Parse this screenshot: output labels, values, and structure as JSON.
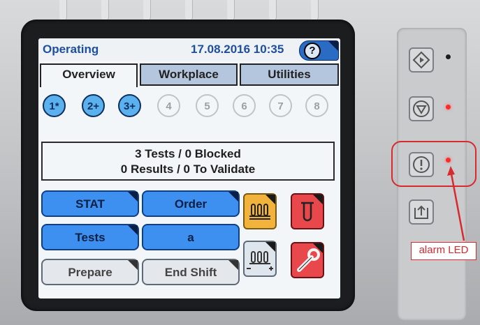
{
  "status": {
    "mode": "Operating",
    "datetime": "17.08.2016 10:35",
    "help_label": "?"
  },
  "tabs": [
    {
      "label": "Overview",
      "active": true
    },
    {
      "label": "Workplace",
      "active": false
    },
    {
      "label": "Utilities",
      "active": false
    }
  ],
  "racks": [
    {
      "label": "1*",
      "active": true
    },
    {
      "label": "2+",
      "active": true
    },
    {
      "label": "3+",
      "active": true
    },
    {
      "label": "4",
      "active": false
    },
    {
      "label": "5",
      "active": false
    },
    {
      "label": "6",
      "active": false
    },
    {
      "label": "7",
      "active": false
    },
    {
      "label": "8",
      "active": false
    }
  ],
  "summary": {
    "line1": "3 Tests / 0 Blocked",
    "line2": "0 Results / 0 To Validate"
  },
  "buttons": {
    "stat": "STAT",
    "order": "Order",
    "tests": "Tests",
    "a": "a",
    "prepare": "Prepare",
    "end_shift": "End Shift"
  },
  "icons": {
    "rack_button": "test-tube-rack-icon",
    "tube_button": "test-tube-icon",
    "rack_adjust_button": "rack-minus-plus-icon",
    "maintenance_button": "wrench-icon",
    "hw_start": "diamond-start-icon",
    "hw_stop": "stop-icon",
    "hw_alarm": "exclamation-icon",
    "hw_eject": "eject-tray-icon"
  },
  "colors": {
    "accent_blue": "#3d8ff0",
    "rack_yellow": "#f1b33b",
    "alert_red": "#e8474b",
    "led_red": "#ff2a2a",
    "annotation_red": "#d8292f"
  },
  "annotation": {
    "label": "alarm LED"
  }
}
